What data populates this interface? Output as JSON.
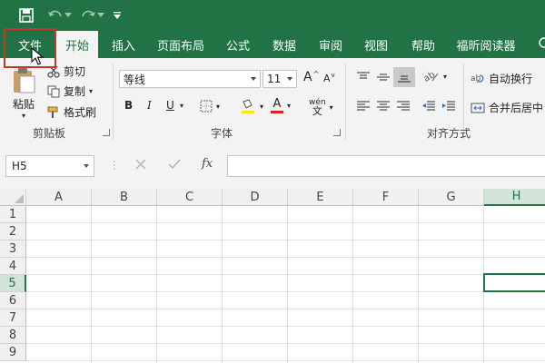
{
  "quick_access": {
    "save": "save-icon",
    "undo": "undo-icon",
    "redo": "redo-icon",
    "customize": "customize-icon"
  },
  "tabs": [
    {
      "label": "文件"
    },
    {
      "label": "开始"
    },
    {
      "label": "插入"
    },
    {
      "label": "页面布局"
    },
    {
      "label": "公式"
    },
    {
      "label": "数据"
    },
    {
      "label": "审阅"
    },
    {
      "label": "视图"
    },
    {
      "label": "帮助"
    },
    {
      "label": "福昕阅读器"
    }
  ],
  "ribbon": {
    "clipboard": {
      "paste": "粘贴",
      "cut": "剪切",
      "copy": "复制",
      "format_painter": "格式刷",
      "label": "剪贴板"
    },
    "font": {
      "name": "等线",
      "size": "11",
      "bold": "B",
      "italic": "I",
      "underline": "U",
      "font_color_letter": "A",
      "label": "字体",
      "wen": "wén",
      "grow": "A",
      "shrink": "A"
    },
    "alignment": {
      "wrap": "自动换行",
      "merge": "合并后居中",
      "label": "对齐方式"
    }
  },
  "formula_bar": {
    "name_box": "H5",
    "fx": "fx"
  },
  "columns": [
    "A",
    "B",
    "C",
    "D",
    "E",
    "F",
    "G",
    "H"
  ],
  "rows": [
    "1",
    "2",
    "3",
    "4",
    "5",
    "6",
    "7",
    "8",
    "9"
  ],
  "selected_cell": {
    "column": "H",
    "row": "5"
  },
  "colors": {
    "brand": "#217346",
    "highlight": "#c0392b"
  }
}
